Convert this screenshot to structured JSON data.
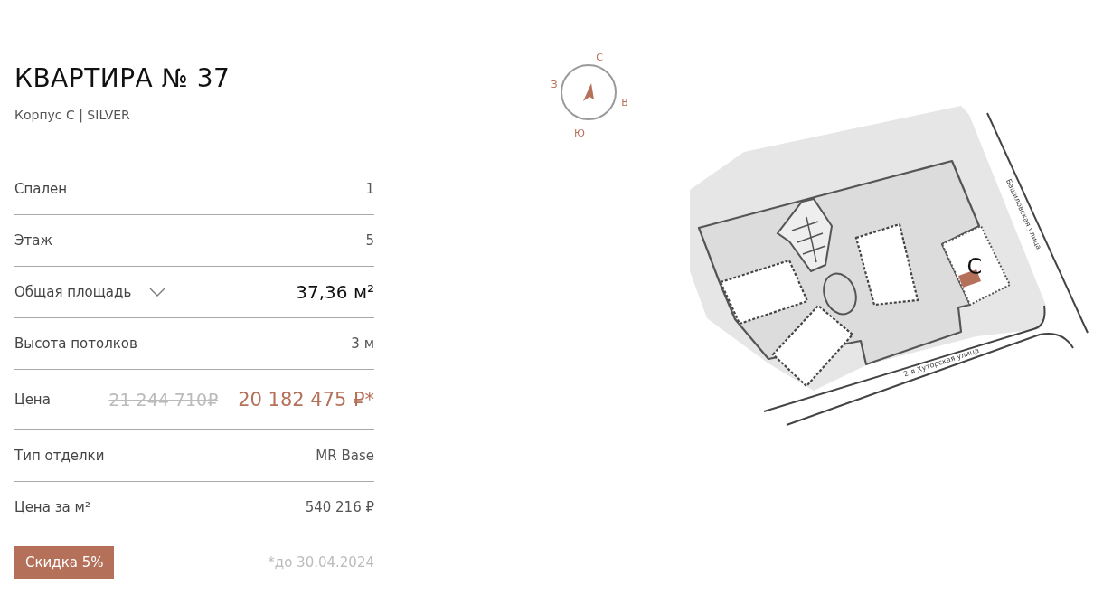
{
  "apartment": {
    "title": "КВАРТИРА № 37",
    "subtitle": "Корпус С | SILVER"
  },
  "specs": [
    {
      "kind": "plain",
      "label": "Спален",
      "value": "1"
    },
    {
      "kind": "plain",
      "label": "Этаж",
      "value": "5"
    },
    {
      "kind": "area",
      "label": "Общая площадь",
      "value": "37,36 м²",
      "expanded": false
    },
    {
      "kind": "plain",
      "label": "Высота потолков",
      "value": "3 м"
    },
    {
      "kind": "price",
      "label": "Цена",
      "old_value": "21 244 710₽",
      "value": "20 182 475 ₽*"
    },
    {
      "kind": "plain",
      "label": "Тип отделки",
      "value": "MR Base"
    },
    {
      "kind": "plain",
      "label": "Цена за м²",
      "value": "540 216 ₽"
    }
  ],
  "discount": {
    "badge": "Скидка 5%",
    "note": "*до 30.04.2024"
  },
  "compass": {
    "north": "С",
    "east": "В",
    "south": "Ю",
    "west": "З"
  },
  "site_plan": {
    "building_label": "С",
    "streets": [
      "Башиловская улица",
      "2-я Хуторская улица"
    ]
  }
}
